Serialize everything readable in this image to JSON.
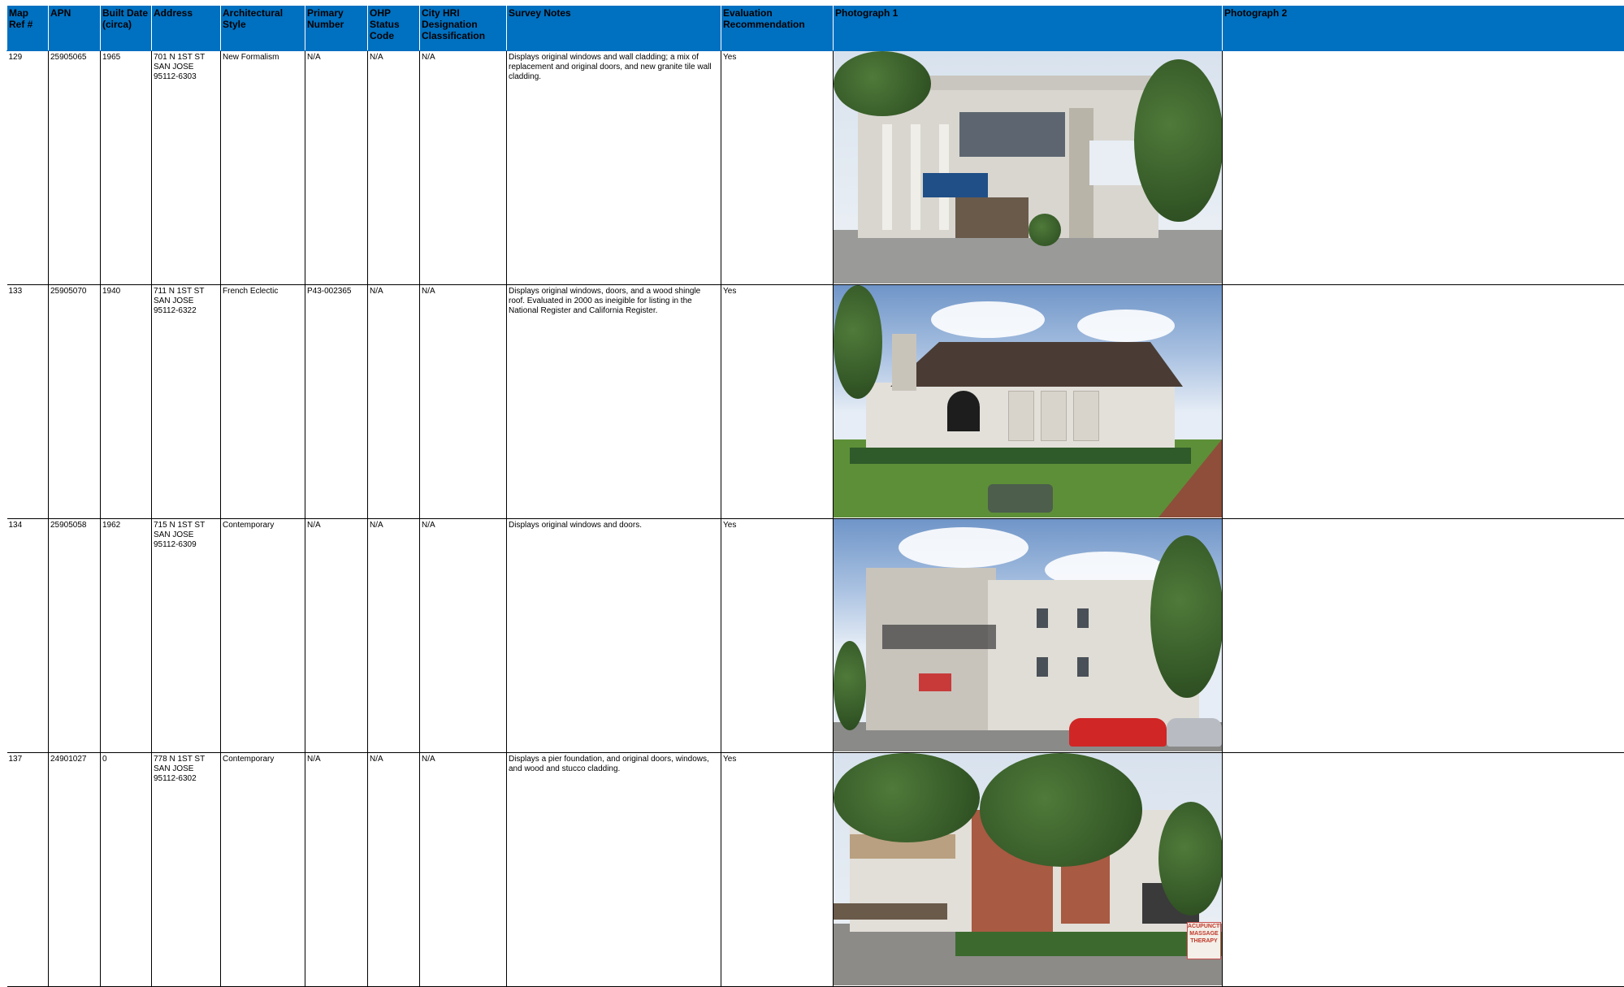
{
  "headers": {
    "map_ref": "Map Ref #",
    "apn": "APN",
    "built_date": "Built Date (circa)",
    "address": "Address",
    "arch_style": "Architectural Style",
    "primary_number": "Primary Number",
    "ohp_status": "OHP Status Code",
    "hri": "City HRI Designation Classification",
    "survey_notes": "Survey Notes",
    "evaluation": "Evaluation Recommendation",
    "photo1": "Photograph 1",
    "photo2": "Photograph 2"
  },
  "rows": [
    {
      "map_ref": "129",
      "apn": "25905065",
      "built": "1965",
      "addr1": "701 N 1ST ST",
      "addr2": "SAN JOSE",
      "addr3": "95112-6303",
      "style": "New Formalism",
      "primary": "N/A",
      "ohp": "N/A",
      "hri": "N/A",
      "notes": "Displays original windows and wall cladding; a mix of replacement and original doors, and new granite tile wall cladding.",
      "eval": "Yes"
    },
    {
      "map_ref": "133",
      "apn": "25905070",
      "built": "1940",
      "addr1": "711 N 1ST ST",
      "addr2": "SAN JOSE",
      "addr3": "95112-6322",
      "style": "French Eclectic",
      "primary": "P43-002365",
      "ohp": "N/A",
      "hri": "N/A",
      "notes": "Displays original windows, doors, and a wood shingle roof. Evaluated in 2000 as ineigible for listing in the National Register and California Register.",
      "eval": "Yes"
    },
    {
      "map_ref": "134",
      "apn": "25905058",
      "built": "1962",
      "addr1": "715 N 1ST ST",
      "addr2": "SAN JOSE",
      "addr3": "95112-6309",
      "style": "Contemporary",
      "primary": "N/A",
      "ohp": "N/A",
      "hri": "N/A",
      "notes": "Displays original windows and doors.",
      "eval": "Yes"
    },
    {
      "map_ref": "137",
      "apn": "24901027",
      "built": "0",
      "addr1": "778 N 1ST ST",
      "addr2": "SAN JOSE",
      "addr3": "95112-6302",
      "style": "Contemporary",
      "primary": "N/A",
      "ohp": "N/A",
      "hri": "N/A",
      "notes": "Displays a pier foundation, and original doors, windows, and wood and stucco cladding.",
      "eval": "Yes"
    }
  ],
  "photo_signs": {
    "sign_row4": "ACUPUNCTURE MASSAGE THERAPY"
  },
  "colors": {
    "header_fill": "#0070C0"
  }
}
